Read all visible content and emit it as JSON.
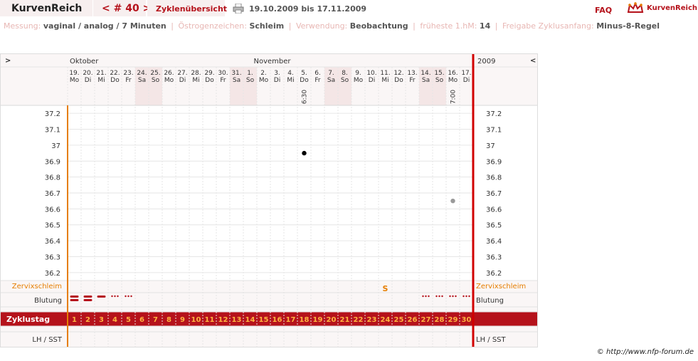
{
  "header": {
    "app_title": "KurvenReich",
    "cycle_prefix": "< # 40 >",
    "overview_label": "Zyklenübersicht",
    "date_range": "19.10.2009 bis 17.11.2009",
    "faq_label": "FAQ",
    "brand_label": "KurvenReich"
  },
  "info": {
    "messung_label": "Messung:",
    "messung_value": "vaginal / analog / 7 Minuten",
    "oestrogen_label": "Östrogenzeichen:",
    "oestrogen_value": "Schleim",
    "verwendung_label": "Verwendung:",
    "verwendung_value": "Beobachtung",
    "fhm_label": "früheste 1.hM:",
    "fhm_value": "14",
    "freigabe_label": "Freigabe Zyklusanfang:",
    "freigabe_value": "Minus-8-Regel"
  },
  "chart_nav": {
    "left": ">",
    "right": "<",
    "year": "2009"
  },
  "months": [
    {
      "label": "Oktober",
      "col": 0
    },
    {
      "label": "November",
      "col": 13
    }
  ],
  "days": [
    {
      "d": "19.",
      "w": "Mo"
    },
    {
      "d": "20.",
      "w": "Di"
    },
    {
      "d": "21.",
      "w": "Mi"
    },
    {
      "d": "22.",
      "w": "Do"
    },
    {
      "d": "23.",
      "w": "Fr"
    },
    {
      "d": "24.",
      "w": "Sa",
      "we": true
    },
    {
      "d": "25.",
      "w": "So",
      "we": true
    },
    {
      "d": "26.",
      "w": "Mo"
    },
    {
      "d": "27.",
      "w": "Di"
    },
    {
      "d": "28.",
      "w": "Mi"
    },
    {
      "d": "29.",
      "w": "Do"
    },
    {
      "d": "30.",
      "w": "Fr"
    },
    {
      "d": "31.",
      "w": "Sa",
      "we": true
    },
    {
      "d": "1.",
      "w": "So",
      "we": true
    },
    {
      "d": "2.",
      "w": "Mo"
    },
    {
      "d": "3.",
      "w": "Di"
    },
    {
      "d": "4.",
      "w": "Mi"
    },
    {
      "d": "5.",
      "w": "Do",
      "time": "6:30"
    },
    {
      "d": "6.",
      "w": "Fr"
    },
    {
      "d": "7.",
      "w": "Sa",
      "we": true
    },
    {
      "d": "8.",
      "w": "So",
      "we": true
    },
    {
      "d": "9.",
      "w": "Mo"
    },
    {
      "d": "10.",
      "w": "Di"
    },
    {
      "d": "11.",
      "w": "Mi"
    },
    {
      "d": "12.",
      "w": "Do"
    },
    {
      "d": "13.",
      "w": "Fr"
    },
    {
      "d": "14.",
      "w": "Sa",
      "we": true
    },
    {
      "d": "15.",
      "w": "So",
      "we": true
    },
    {
      "d": "16.",
      "w": "Mo",
      "time": "7:00"
    },
    {
      "d": "17.",
      "w": "Di"
    }
  ],
  "chart_data": {
    "type": "scatter",
    "y_ticks": [
      "37.2",
      "37.1",
      "37",
      "36.9",
      "36.8",
      "36.7",
      "36.6",
      "36.5",
      "36.4",
      "36.3",
      "36.2"
    ],
    "ylim": [
      36.15,
      37.25
    ],
    "points": [
      {
        "day": 17,
        "value": 36.95,
        "color": "#000000"
      },
      {
        "day": 28,
        "value": 36.65,
        "color": "#999999"
      }
    ]
  },
  "rows": {
    "zervix_label": "Zervixschleim",
    "zervix_marks": [
      {
        "day": 23,
        "mark": "S"
      }
    ],
    "blutung_label": "Blutung",
    "blutung_marks": [
      {
        "day": 0,
        "type": "heavy"
      },
      {
        "day": 1,
        "type": "heavy"
      },
      {
        "day": 2,
        "type": "medium"
      },
      {
        "day": 3,
        "type": "light"
      },
      {
        "day": 4,
        "type": "light"
      },
      {
        "day": 26,
        "type": "light"
      },
      {
        "day": 27,
        "type": "light"
      },
      {
        "day": 28,
        "type": "light"
      },
      {
        "day": 29,
        "type": "light"
      }
    ],
    "zyklustag_label": "Zyklustag",
    "zyklustag_values": [
      "1",
      "2",
      "3",
      "4",
      "5",
      "6",
      "7",
      "8",
      "9",
      "10",
      "11",
      "12",
      "13",
      "14",
      "15",
      "16",
      "17",
      "18",
      "19",
      "20",
      "21",
      "22",
      "23",
      "24",
      "25",
      "26",
      "27",
      "28",
      "29",
      "30"
    ],
    "lh_label": "LH / SST"
  },
  "colors": {
    "accent": "#b5121b",
    "orange": "#e67e00",
    "weekend": "#f4e6e6",
    "grid": "#e6e6e6"
  },
  "footer": "© http://www.nfp-forum.de"
}
